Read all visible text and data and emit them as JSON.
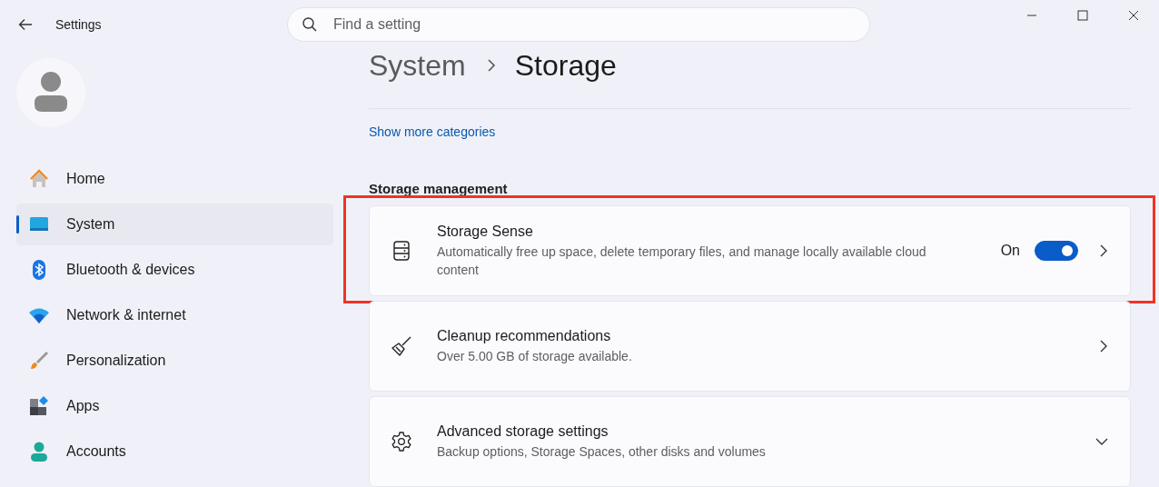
{
  "window": {
    "title": "Settings"
  },
  "search": {
    "placeholder": "Find a setting"
  },
  "sidebar": {
    "items": [
      {
        "label": "Home",
        "selected": false
      },
      {
        "label": "System",
        "selected": true
      },
      {
        "label": "Bluetooth & devices",
        "selected": false
      },
      {
        "label": "Network & internet",
        "selected": false
      },
      {
        "label": "Personalization",
        "selected": false
      },
      {
        "label": "Apps",
        "selected": false
      },
      {
        "label": "Accounts",
        "selected": false
      }
    ]
  },
  "breadcrumb": {
    "parent": "System",
    "current": "Storage"
  },
  "show_more_link": "Show more categories",
  "section_heading": "Storage management",
  "cards": [
    {
      "kind": "toggle",
      "title": "Storage Sense",
      "description": "Automatically free up space, delete temporary files, and manage locally available cloud content",
      "toggle": {
        "label": "On",
        "on": true
      },
      "highlighted": true
    },
    {
      "kind": "link",
      "title": "Cleanup recommendations",
      "description": "Over 5.00 GB of storage available.",
      "highlighted": false
    },
    {
      "kind": "expander",
      "title": "Advanced storage settings",
      "description": "Backup options, Storage Spaces, other disks and volumes",
      "highlighted": false
    }
  ]
}
